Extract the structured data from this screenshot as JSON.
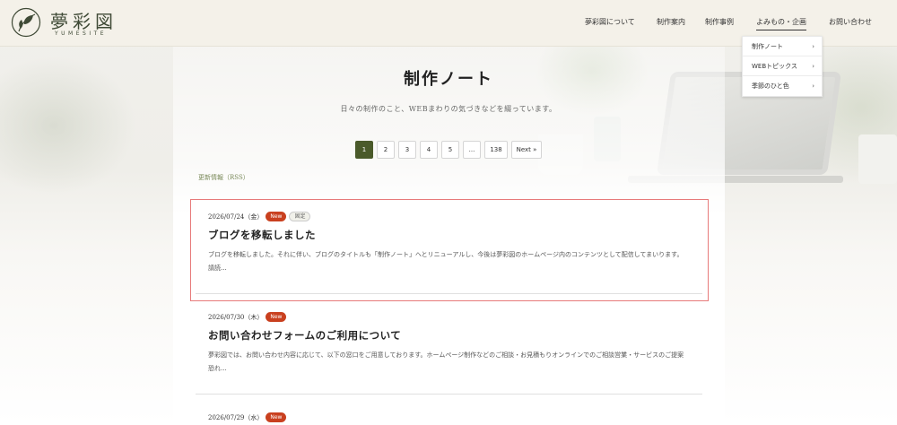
{
  "brand": {
    "name": "夢彩図",
    "sub": "YUMESITE"
  },
  "nav": [
    {
      "label": "夢彩図について"
    },
    {
      "label": "制作案内"
    },
    {
      "label": "制作事例"
    },
    {
      "label": "よみもの・企画"
    },
    {
      "label": "お問い合わせ"
    }
  ],
  "dropdown": [
    {
      "label": "制作ノート"
    },
    {
      "label": "WEBトピックス"
    },
    {
      "label": "季節のひと色"
    }
  ],
  "page": {
    "title": "制作ノート",
    "lead": "日々の制作のこと、WEBまわりの気づきなどを綴っています。",
    "rss": "更新情報（RSS）"
  },
  "pager": [
    "1",
    "2",
    "3",
    "4",
    "5",
    "...",
    "138",
    "Next »"
  ],
  "posts": [
    {
      "date": "2026/07/24（金）",
      "badge_new": "New",
      "badge_pin": "固定",
      "title": "ブログを移転しました",
      "excerpt": "ブログを移転しました。それに伴い、ブログのタイトルも「制作ノート」へとリニューアルし、今後は夢彩図のホームページ内のコンテンツとして配信してまいります。請読..."
    },
    {
      "date": "2026/07/30（木）",
      "badge_new": "New",
      "title": "お問い合わせフォームのご利用について",
      "excerpt": "夢彩図では、お問い合わせ内容に応じて、以下の窓口をご用意しております。ホームページ制作などのご相談・お見積もりオンラインでのご相談営業・サービスのご提案恐れ..."
    },
    {
      "date": "2026/07/29（水）",
      "badge_new": "New"
    }
  ]
}
